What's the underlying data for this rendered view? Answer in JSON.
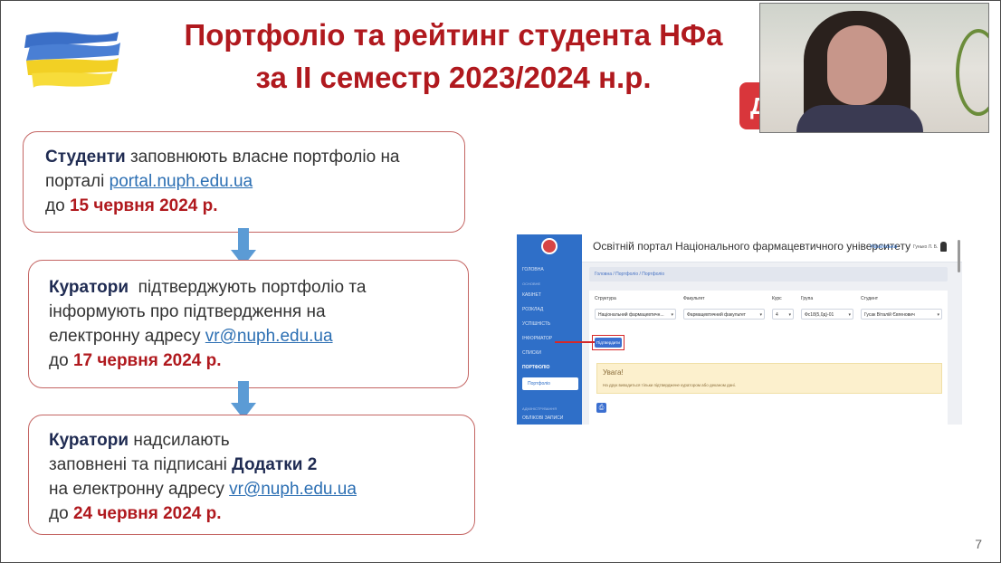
{
  "slide": {
    "title_line1": "Портфоліо та рейтинг студента НФа",
    "title_line2": "за II семестр 2023/2024 н.р.",
    "red_tag_text": "Д",
    "page_number": "7"
  },
  "steps": [
    {
      "actor": "Студенти",
      "text1": " заповнюють власне портфоліо на",
      "text2": "порталі ",
      "link": "portal.nuph.edu.ua",
      "deadline_prefix": "до ",
      "deadline": "15 червня 2024 р."
    },
    {
      "actor": "Куратори",
      "text1": "  підтверджують портфоліо та",
      "text2": "інформують про підтвердження на",
      "text3": "електронну адресу ",
      "link": "vr@nuph.edu.ua",
      "deadline_prefix": "до ",
      "deadline": "17 червня 2024 р."
    },
    {
      "actor": "Куратори",
      "text1": " надсилають",
      "text2": "заповнені та підписані ",
      "text2_bold": "Додатки 2",
      "text3": "на електронну адресу ",
      "link": "vr@nuph.edu.ua",
      "deadline_prefix": "до ",
      "deadline": "24 червня 2024 р."
    }
  ],
  "portal": {
    "title": "Освітній портал Національного фармацевтичного університету",
    "lang": "Українська",
    "user": "Гунько Л. Б.",
    "breadcrumb": "Головна  /  Портфоліо  /  Портфоліо",
    "sidebar": {
      "home": "ГОЛОВНА",
      "section_header": "ОСНОВНЕ",
      "items": [
        "КАБІНЕТ",
        "РОЗКЛАД",
        "УСПІШНІСТЬ",
        "ІНФОРМАТОР",
        "СПИСКИ",
        "ПОРТФОЛІО"
      ],
      "sub_item": "Портфоліо",
      "admin_header": "АДМІНІСТРУВАННЯ",
      "admin_item": "ОБЛІКОВІ ЗАПИСИ"
    },
    "filters": {
      "labels": [
        "Структура",
        "Факультет",
        "Курс",
        "Група",
        "Студент"
      ],
      "values": [
        "Національний фармацевтичн...",
        "Фармацевтичний факультет",
        "4",
        "Фс18(5,0д)-01",
        "Гусак Віталій Євгенович"
      ]
    },
    "confirm_button": "Підтвердити",
    "alert_title": "Увага!",
    "alert_text": "На друк виводиться тільки підтверджене куратором або деканом дані."
  },
  "colors": {
    "title_red": "#b0191e",
    "navy": "#1f2b52",
    "link_blue": "#2c6fb3",
    "box_border": "#c46563",
    "arrow_blue": "#5b9bd5"
  }
}
